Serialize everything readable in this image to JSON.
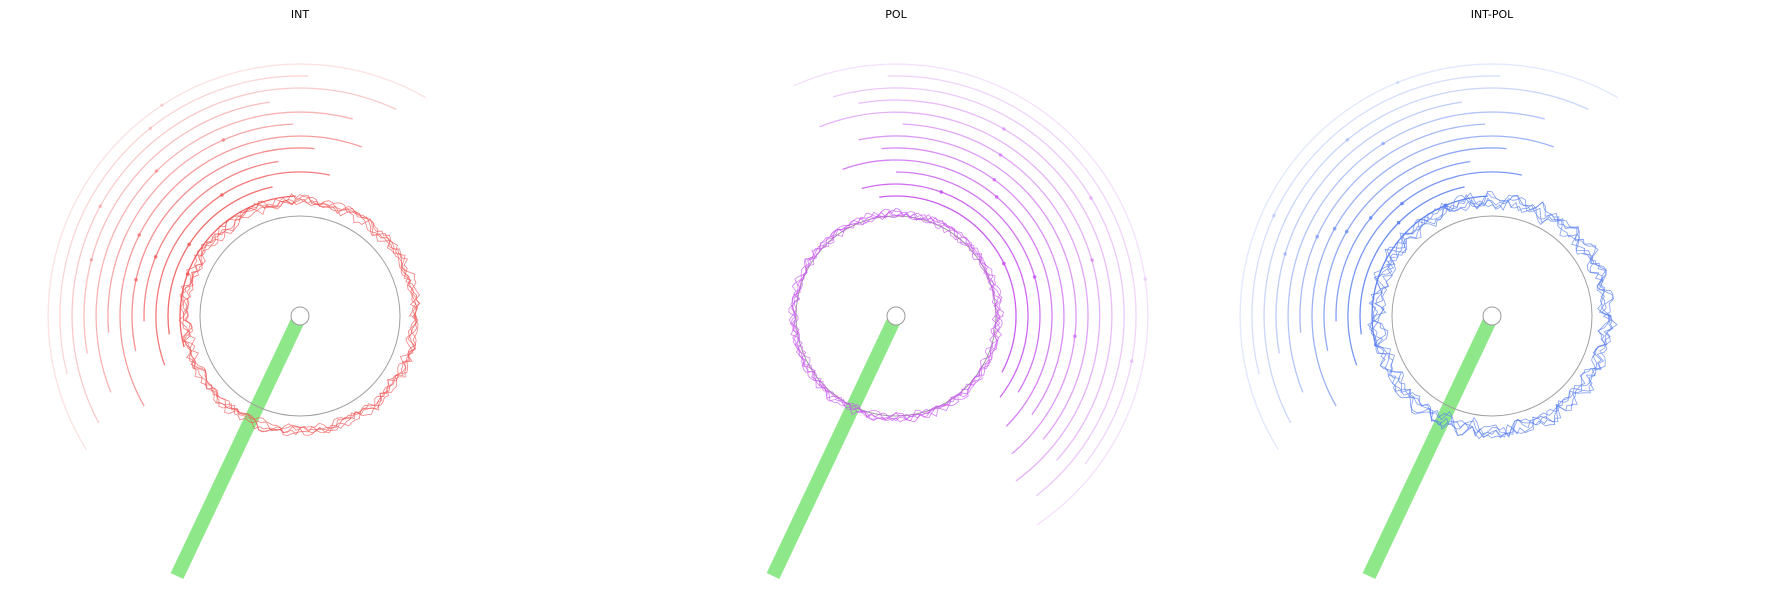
{
  "chart_data": [
    {
      "type": "polar-arc-trace",
      "title": "INT",
      "grid": false,
      "series_color": "#f05a5a",
      "arc_band": "left-upper",
      "arc_count": 12
    },
    {
      "type": "polar-arc-trace",
      "title": "POL",
      "grid": false,
      "series_color": "#c855f0",
      "arc_band": "right",
      "arc_count": 12
    },
    {
      "type": "polar-arc-trace",
      "title": "INT-POL",
      "grid": false,
      "series_color": "#5a7ff0",
      "arc_band": "left-upper",
      "arc_count": 12
    }
  ],
  "colors": {
    "bar": "#8ee88a",
    "reference_circle": "#a0a0a0",
    "center_circle": "#9a9a9a"
  }
}
